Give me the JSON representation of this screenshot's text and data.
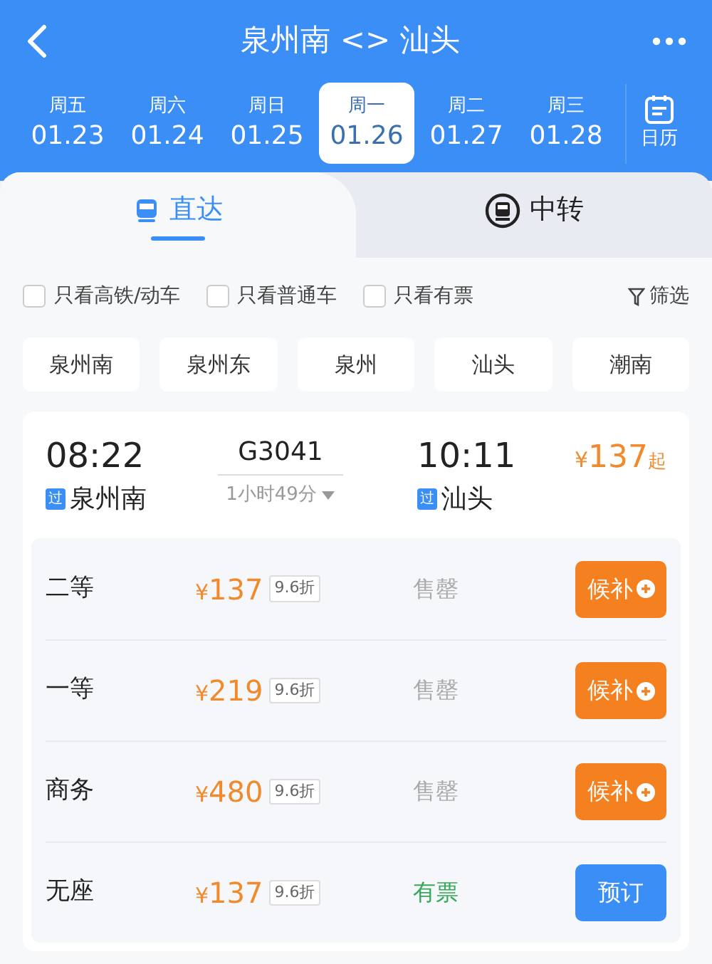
{
  "header": {
    "title": "泉州南 <> 汕头",
    "calendar_label": "日历"
  },
  "dates": [
    {
      "weekday": "周五",
      "date": "01.23",
      "selected": false
    },
    {
      "weekday": "周六",
      "date": "01.24",
      "selected": false
    },
    {
      "weekday": "周日",
      "date": "01.25",
      "selected": false
    },
    {
      "weekday": "周一",
      "date": "01.26",
      "selected": true
    },
    {
      "weekday": "周二",
      "date": "01.27",
      "selected": false
    },
    {
      "weekday": "周三",
      "date": "01.28",
      "selected": false
    }
  ],
  "tabs": [
    {
      "label": "直达",
      "kind": "direct",
      "selected": true
    },
    {
      "label": "中转",
      "kind": "transfer",
      "selected": false
    }
  ],
  "filters": [
    {
      "label": "只看高铁/动车",
      "checked": false
    },
    {
      "label": "只看普通车",
      "checked": false
    },
    {
      "label": "只看有票",
      "checked": false
    }
  ],
  "filter_button": "筛选",
  "stations": [
    "泉州南",
    "泉州东",
    "泉州",
    "汕头",
    "潮南"
  ],
  "train": {
    "depart_time": "08:22",
    "depart_badge": "过",
    "depart_station": "泉州南",
    "number": "G3041",
    "duration": "1小时49分",
    "arrive_time": "10:11",
    "arrive_badge": "过",
    "arrive_station": "汕头",
    "price_currency": "¥",
    "price_amount": "137",
    "price_suffix": "起",
    "seats": [
      {
        "class": "二等",
        "currency": "¥",
        "amount": "137",
        "discount": "9.6折",
        "status": "售罄",
        "available": false,
        "action": "候补",
        "kind": "waitlist"
      },
      {
        "class": "一等",
        "currency": "¥",
        "amount": "219",
        "discount": "9.6折",
        "status": "售罄",
        "available": false,
        "action": "候补",
        "kind": "waitlist"
      },
      {
        "class": "商务",
        "currency": "¥",
        "amount": "480",
        "discount": "9.6折",
        "status": "售罄",
        "available": false,
        "action": "候补",
        "kind": "waitlist"
      },
      {
        "class": "无座",
        "currency": "¥",
        "amount": "137",
        "discount": "9.6折",
        "status": "有票",
        "available": true,
        "action": "预订",
        "kind": "book"
      }
    ]
  }
}
